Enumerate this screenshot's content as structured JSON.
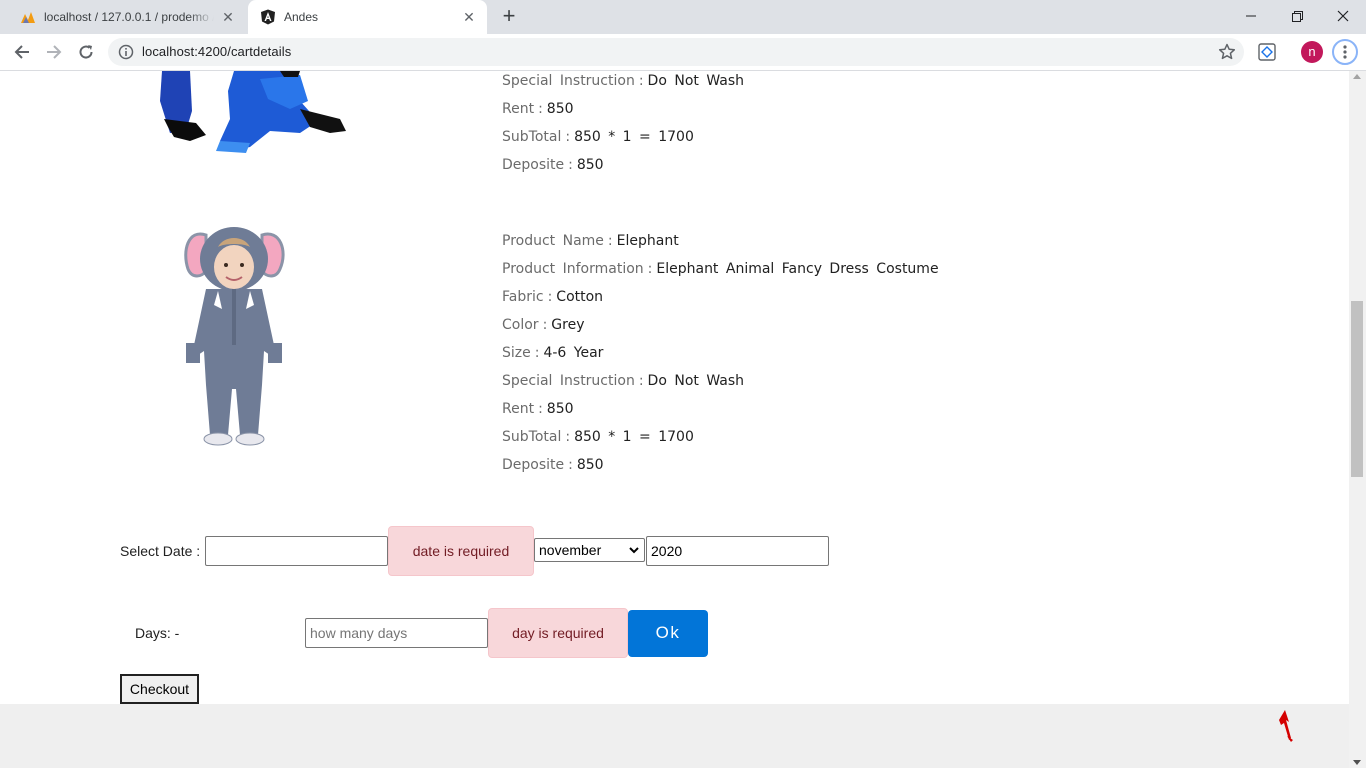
{
  "browser": {
    "tabs": [
      {
        "title": "localhost / 127.0.0.1 / prodemo / ",
        "favicon": "phpmyadmin-icon",
        "active": false
      },
      {
        "title": "Andes",
        "favicon": "angular-icon",
        "active": true
      }
    ],
    "url": "localhost:4200/cartdetails",
    "profile_initial": "n",
    "profile_color": "#c2185b"
  },
  "products": [
    {
      "details": [
        {
          "label": "Special Instruction",
          "value": "Do Not Wash"
        },
        {
          "label": "Rent",
          "value": "850"
        },
        {
          "label": "SubTotal",
          "value": "850 * 1 = 1700"
        },
        {
          "label": "Deposite",
          "value": "850"
        }
      ]
    },
    {
      "details": [
        {
          "label": "Product Name",
          "value": "Elephant"
        },
        {
          "label": "Product Information",
          "value": "Elephant Animal Fancy Dress Costume"
        },
        {
          "label": "Fabric",
          "value": "Cotton"
        },
        {
          "label": "Color",
          "value": "Grey"
        },
        {
          "label": "Size",
          "value": "4-6 Year"
        },
        {
          "label": "Special Instruction",
          "value": "Do Not Wash"
        },
        {
          "label": "Rent",
          "value": "850"
        },
        {
          "label": "SubTotal",
          "value": "850 * 1 = 1700"
        },
        {
          "label": "Deposite",
          "value": "850"
        }
      ]
    }
  ],
  "separator": ":",
  "form": {
    "select_date_label": "Select Date :",
    "date_value": "",
    "date_error": "date is required",
    "month_value": "november",
    "year_value": "2020",
    "days_label": "Days: -",
    "days_placeholder": "how many days",
    "days_error": "day is required",
    "ok_label": "Ok",
    "checkout_label": "Checkout"
  },
  "colors": {
    "primary": "#0275d8",
    "alert_bg": "#f8d7da",
    "alert_text": "#721c24",
    "footer_bg": "#efefef"
  }
}
